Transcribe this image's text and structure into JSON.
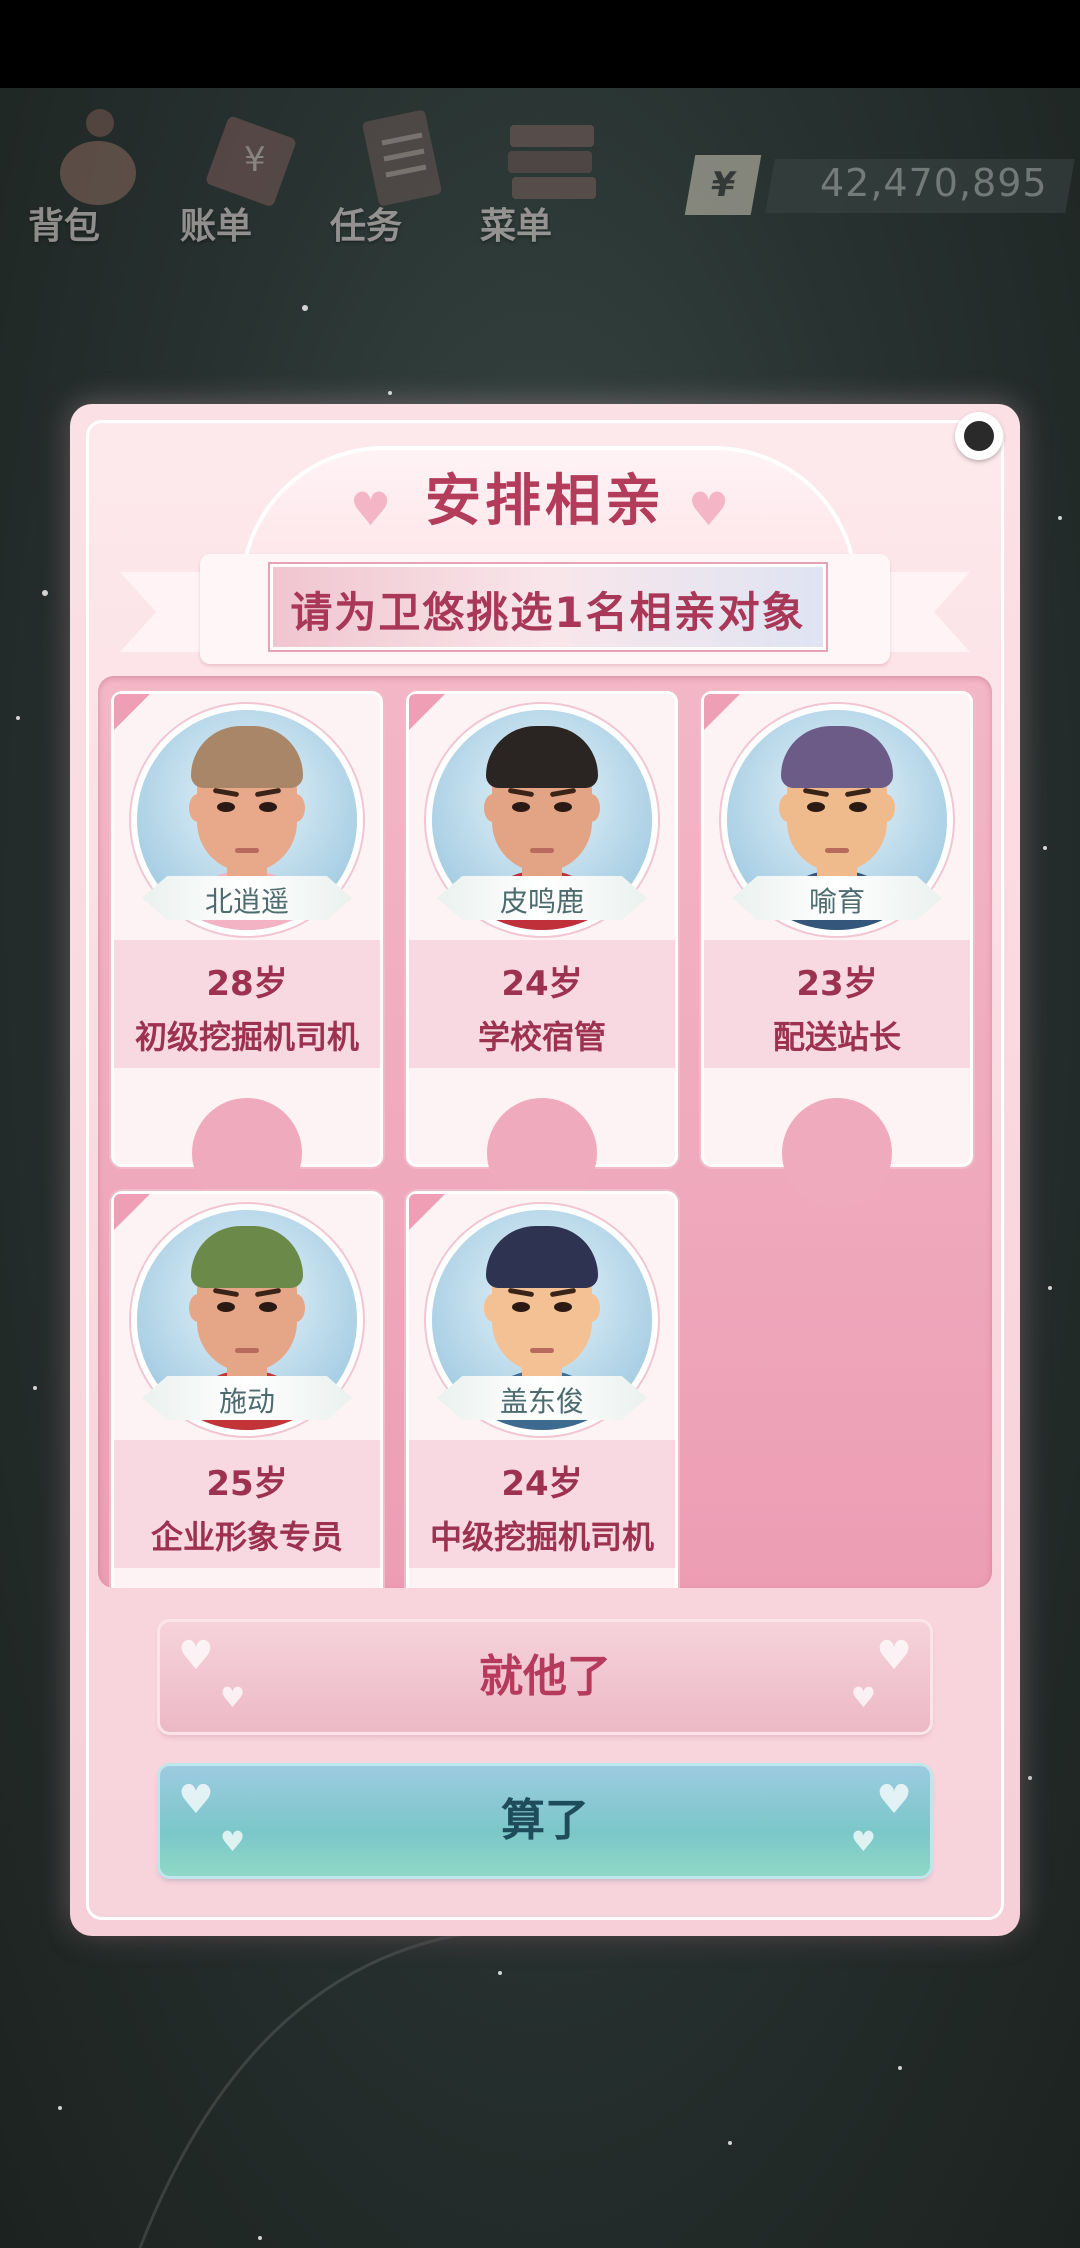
{
  "hud": {
    "items": [
      {
        "label": "背包",
        "icon": "backpack-icon"
      },
      {
        "label": "账单",
        "icon": "bill-icon"
      },
      {
        "label": "任务",
        "icon": "task-icon"
      },
      {
        "label": "菜单",
        "icon": "menu-icon"
      }
    ],
    "currency_symbol": "¥",
    "money": "42,470,895"
  },
  "dialog": {
    "title": "安排相亲",
    "subtitle": "请为卫悠挑选1名相亲对象",
    "candidates": [
      {
        "name": "北逍遥",
        "age": "28岁",
        "job": "初级挖掘机司机",
        "hair": "#a88667",
        "shirt": "#f3b3c4",
        "skin": "#e7a989"
      },
      {
        "name": "皮鸣鹿",
        "age": "24岁",
        "job": "学校宿管",
        "hair": "#2a2523",
        "shirt": "#c0303a",
        "skin": "#e3a385"
      },
      {
        "name": "喻育",
        "age": "23岁",
        "job": "配送站长",
        "hair": "#6c5b86",
        "shirt": "#33567a",
        "skin": "#f0bb8c"
      },
      {
        "name": "施动",
        "age": "25岁",
        "job": "企业形象专员",
        "hair": "#6b8a4a",
        "shirt": "#c23437",
        "skin": "#e5a688"
      },
      {
        "name": "盖东俊",
        "age": "24岁",
        "job": "中级挖掘机司机",
        "hair": "#2f3352",
        "shirt": "#3d6a8e",
        "skin": "#f3c193"
      }
    ],
    "confirm_label": "就他了",
    "cancel_label": "算了"
  },
  "colors": {
    "accent": "#b23c5a",
    "panel": "#f3b7c7",
    "cancel": "#7bc7c9"
  }
}
